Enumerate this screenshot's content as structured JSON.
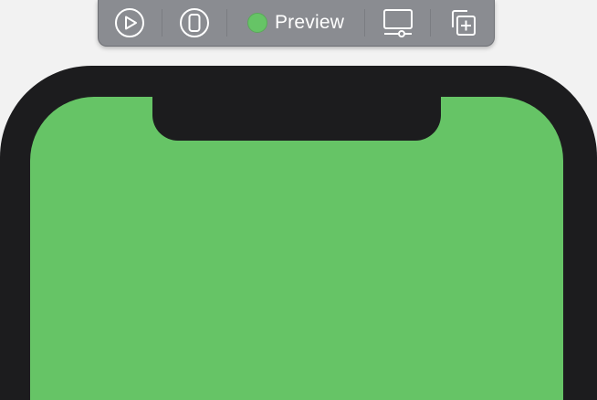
{
  "toolbar": {
    "buttons": [
      {
        "id": "live-preview",
        "icon": "play-circle-icon"
      },
      {
        "id": "device",
        "icon": "device-icon"
      },
      {
        "id": "preview",
        "icon": "status-dot-icon",
        "label": "Preview",
        "status_color": "#66c466"
      },
      {
        "id": "device-settings",
        "icon": "display-settings-icon"
      },
      {
        "id": "duplicate",
        "icon": "duplicate-add-icon"
      }
    ]
  },
  "device": {
    "frame_color": "#1c1c1e",
    "screen_color": "#66c466"
  },
  "colors": {
    "background": "#f2f2f2",
    "toolbar": "#8a8c91",
    "accent_green": "#66c466"
  }
}
